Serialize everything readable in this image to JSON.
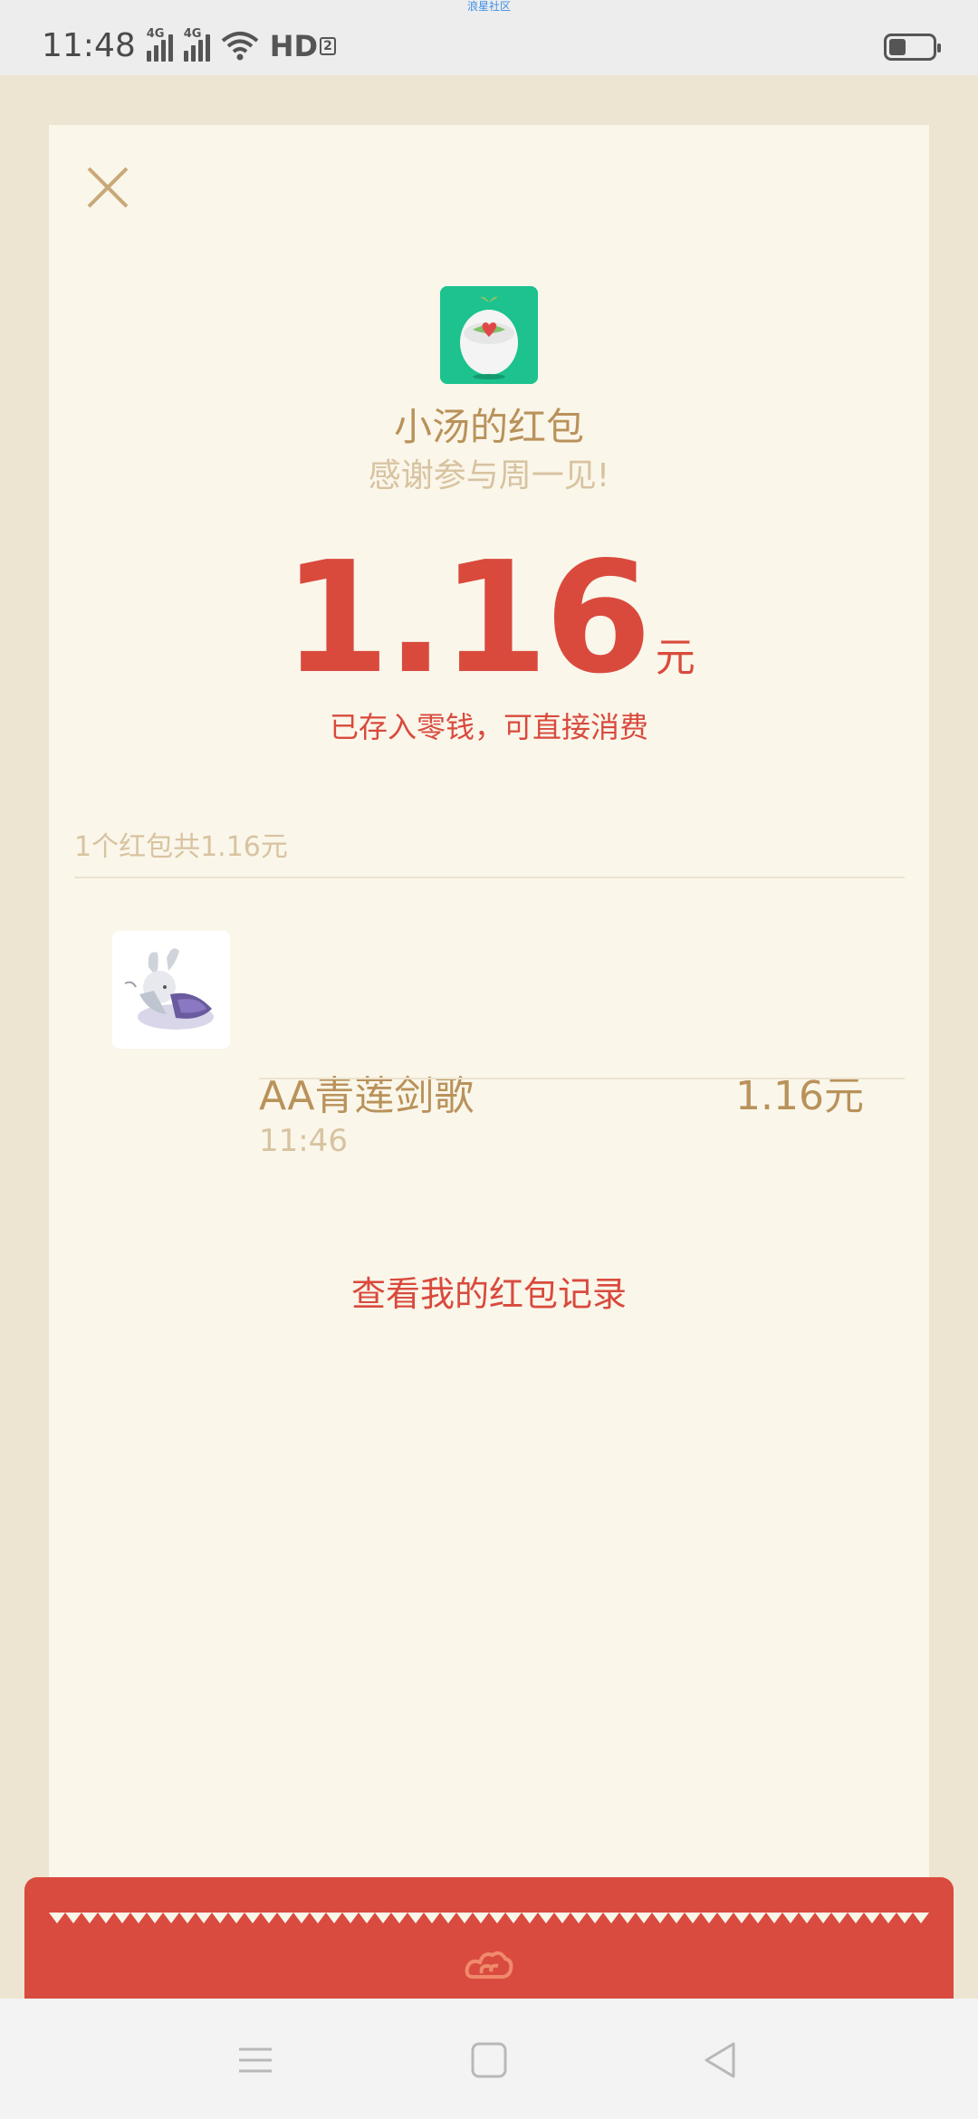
{
  "status_bar": {
    "carrier_banner": "浪星社区",
    "time": "11:48",
    "signal1_label": "4G",
    "signal2_label": "4G",
    "hd_label": "HD",
    "hd_sub": "2"
  },
  "packet": {
    "sender_title": "小汤的红包",
    "blessing": "感谢参与周一见!",
    "amount": "1.16",
    "unit": "元",
    "deposit_note": "已存入零钱，可直接消费",
    "summary": "1个红包共1.16元"
  },
  "records": [
    {
      "name": "AA青莲剑歌",
      "time": "11:46",
      "amount": "1.16元"
    }
  ],
  "links": {
    "view_records": "查看我的红包记录"
  },
  "colors": {
    "accent_red": "#d94a3d",
    "gold_text": "#b9925a",
    "muted_gold": "#d8c3a0",
    "card_bg": "#faf6ea",
    "page_bg": "#ede4d1",
    "app_icon_green": "#1dc28e"
  },
  "icons": {
    "close": "close-icon",
    "app": "app-logo-icon",
    "footer": "lucky-cloud-icon",
    "nav_menu": "menu-icon",
    "nav_home": "home-square-icon",
    "nav_back": "back-triangle-icon"
  }
}
